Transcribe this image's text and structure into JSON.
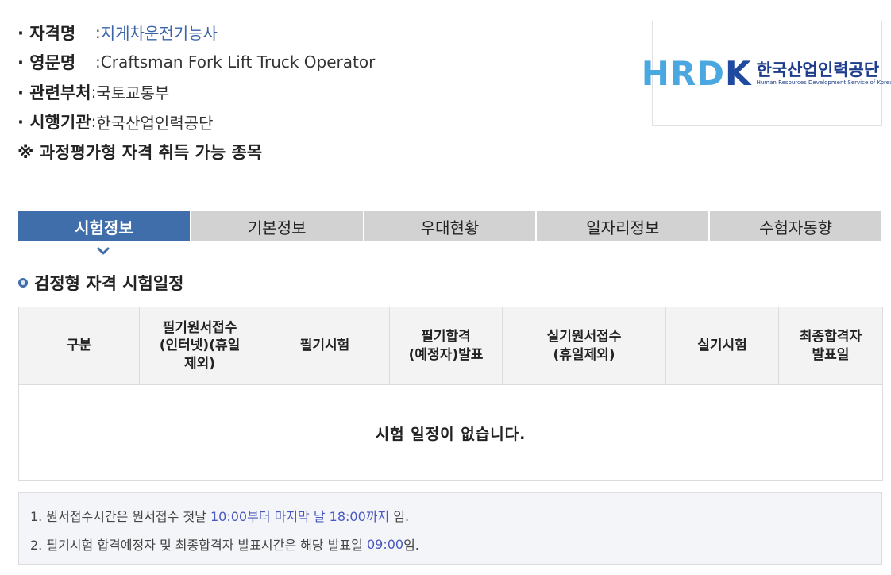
{
  "info": {
    "rows": [
      {
        "key": "· 자격명",
        "sep": " : ",
        "value": "지게차운전기능사"
      },
      {
        "key": "· 영문명",
        "sep": " : ",
        "value": "Craftsman Fork Lift Truck Operator"
      },
      {
        "key": "· 관련부처",
        "sep": " : ",
        "value": "국토교통부"
      },
      {
        "key": "· 시행기관",
        "sep": " : ",
        "value": "한국산업인력공단"
      }
    ],
    "note": "※ 과정평가형 자격 취득 가능 종목"
  },
  "logo": {
    "mark_light": "HRD",
    "mark_dark": "K",
    "ko": "한국산업인력공단",
    "en": "Human Resources Development Service of Korea"
  },
  "tabs": [
    {
      "label": "시험정보",
      "active": true
    },
    {
      "label": "기본정보",
      "active": false
    },
    {
      "label": "우대현황",
      "active": false
    },
    {
      "label": "일자리정보",
      "active": false
    },
    {
      "label": "수험자동향",
      "active": false
    }
  ],
  "section": {
    "title": "검정형 자격 시험일정"
  },
  "table": {
    "headers": [
      [
        "구분"
      ],
      [
        "필기원서접수",
        "(인터넷)(휴일",
        "제외)"
      ],
      [
        "필기시험"
      ],
      [
        "필기합격",
        "(예정자)발표"
      ],
      [
        "실기원서접수",
        "(휴일제외)"
      ],
      [
        "실기시험"
      ],
      [
        "최종합격자",
        "발표일"
      ]
    ],
    "empty": "시험 일정이 없습니다."
  },
  "notes": {
    "n1_prefix": "1. 원서접수시간은 원서접수 첫날 ",
    "n1_highlight": "10:00부터 마지막 날 18:00까지",
    "n1_suffix": " 임.",
    "n2_prefix": "2. 필기시험 합격예정자 및 최종합격자 발표시간은 해당 발표일 ",
    "n2_highlight": "09:00",
    "n2_suffix": "임."
  },
  "colors": {
    "accent": "#3f6eab",
    "tab_inactive": "#d2d2d2",
    "value_blue": "#3a64a6",
    "note_highlight": "#4a57c0"
  }
}
